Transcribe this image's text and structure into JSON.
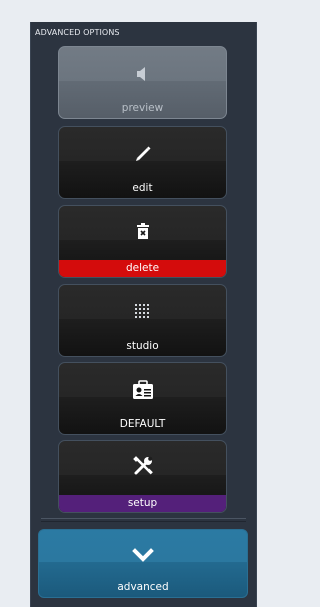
{
  "panel": {
    "title": "ADVANCED OPTIONS"
  },
  "buttons": [
    {
      "id": "preview",
      "label": "preview",
      "icon": "speaker-icon",
      "enabled": false
    },
    {
      "id": "edit",
      "label": "edit",
      "icon": "pencil-icon"
    },
    {
      "id": "delete",
      "label": "delete",
      "icon": "trash-icon",
      "band_color": "#d40c0c"
    },
    {
      "id": "studio",
      "label": "studio",
      "icon": "dotted-grid-icon"
    },
    {
      "id": "default",
      "label": "DEFAULT",
      "icon": "id-badge-icon"
    },
    {
      "id": "setup",
      "label": "setup",
      "icon": "tools-icon",
      "band_color": "#54207a"
    },
    {
      "id": "advanced",
      "label": "advanced",
      "icon": "chevron-down-icon",
      "color": "#2b78a0"
    }
  ]
}
